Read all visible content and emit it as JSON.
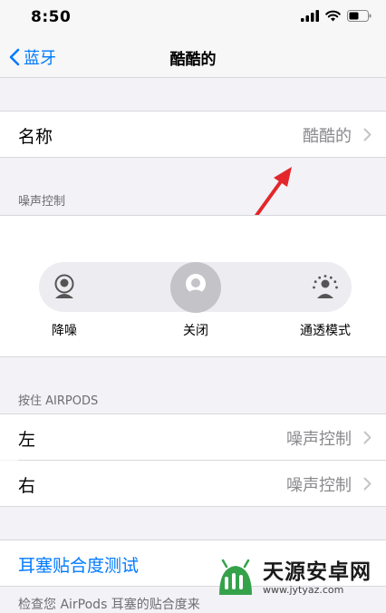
{
  "status_bar": {
    "time": "8:50"
  },
  "nav": {
    "back_label": "蓝牙",
    "title": "酷酷的"
  },
  "name_row": {
    "label": "名称",
    "value": "酷酷的"
  },
  "noise_control": {
    "header": "噪声控制",
    "modes": [
      {
        "label": "降噪",
        "icon": "person-noise-cancel-icon"
      },
      {
        "label": "关闭",
        "icon": "person-off-icon",
        "selected": true
      },
      {
        "label": "通透模式",
        "icon": "person-transparency-icon"
      }
    ]
  },
  "press_hold": {
    "header": "按住 AIRPODS",
    "rows": [
      {
        "label": "左",
        "value": "噪声控制"
      },
      {
        "label": "右",
        "value": "噪声控制"
      }
    ]
  },
  "fit_test": {
    "label": "耳塞贴合度测试"
  },
  "footer": {
    "text": "检查您 AirPods 耳塞的贴合度来"
  },
  "watermark": {
    "title": "天源安卓网",
    "url": "www.jytyaz.com"
  },
  "colors": {
    "accent": "#007aff",
    "arrow": "#e3262b",
    "background": "#f2f2f7"
  }
}
